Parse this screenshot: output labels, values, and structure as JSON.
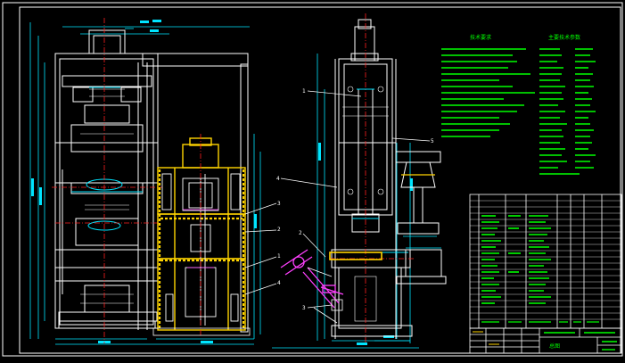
{
  "drawing": {
    "background": "#000000",
    "colors": {
      "frame": "#ffffff",
      "dim": "#00e5ff",
      "part": "#ffffff",
      "highlight": "#ffd400",
      "center": "#ff2020",
      "note": "#00ff00",
      "accent": "#ff40ff"
    },
    "leaders": [
      "1",
      "2",
      "3",
      "4",
      "5",
      "1",
      "2",
      "3",
      "4",
      "5"
    ],
    "notes_left_title": "技术要求",
    "notes_right_title": "主要技术参数",
    "title_block": {
      "name": "总图"
    }
  }
}
